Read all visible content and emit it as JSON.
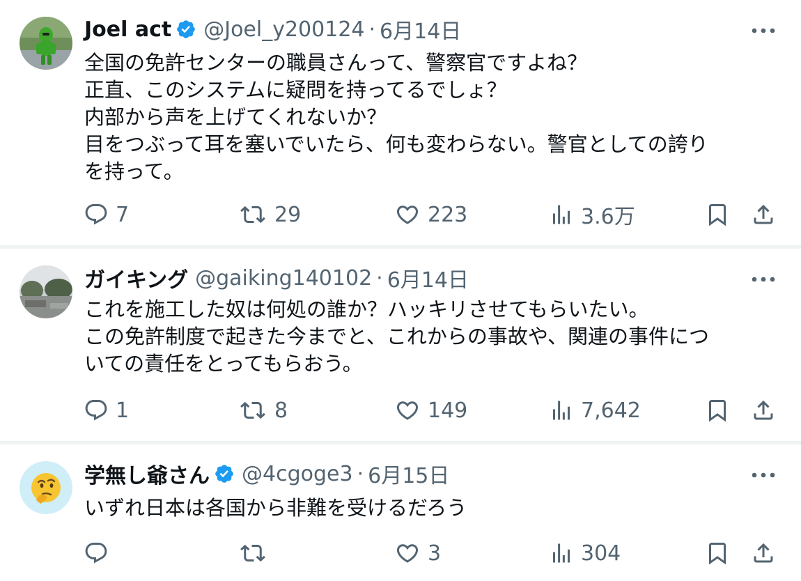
{
  "colors": {
    "text": "#0f1419",
    "muted": "#536471",
    "verified_blue": "#1d9bf0",
    "divider": "#eff3f4"
  },
  "tweets": [
    {
      "name": "Joel act",
      "verified": true,
      "handle": "@Joel_y200124",
      "separator": "·",
      "date": "6月14日",
      "avatar": "green-figure-photo",
      "lines": [
        "全国の免許センターの職員さんって、警察官ですよね？",
        "正直、このシステムに疑問を持ってるでしょ？",
        "内部から声を上げてくれないか？",
        "目をつぶって耳を塞いでいたら、何も変わらない。警官としての誇り",
        "を持って。"
      ],
      "replies": "7",
      "retweets": "29",
      "likes": "223",
      "views": "3.6万"
    },
    {
      "name": "ガイキング",
      "verified": false,
      "handle": "@gaiking140102",
      "separator": "·",
      "date": "6月14日",
      "avatar": "landscape-photo",
      "lines": [
        "これを施工した奴は何処の誰か？ハッキリさせてもらいたい。",
        "この免許制度で起きた今までと、これからの事故や、関連の事件につ",
        "いての責任をとってもらおう。"
      ],
      "replies": "1",
      "retweets": "8",
      "likes": "149",
      "views": "7,642"
    },
    {
      "name": "学無し爺さん",
      "verified": true,
      "handle": "@4cgoge3",
      "separator": "·",
      "date": "6月15日",
      "avatar": "thinking-face-emoji",
      "lines": [
        "いずれ日本は各国から非難を受けるだろう"
      ],
      "replies": "",
      "retweets": "",
      "likes": "3",
      "views": "304"
    }
  ]
}
